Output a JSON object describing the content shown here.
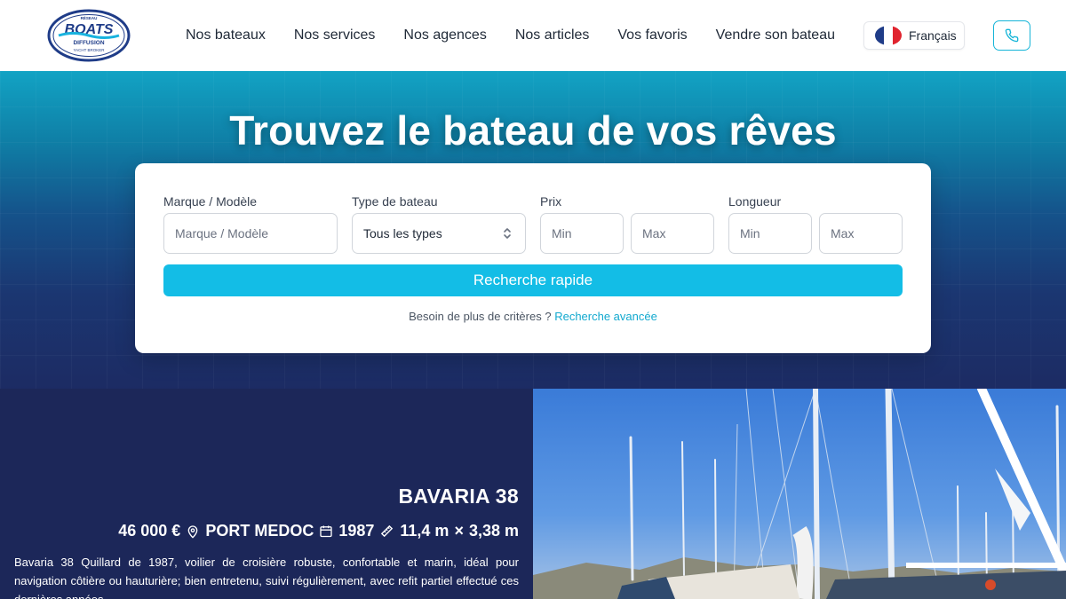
{
  "header": {
    "logo": {
      "top": "RÉSEAU",
      "main": "BOATS",
      "sub": "DIFFUSION",
      "tagline": "YACHT BROKER"
    },
    "nav": [
      "Nos bateaux",
      "Nos services",
      "Nos agences",
      "Nos articles",
      "Vos favoris",
      "Vendre son bateau"
    ],
    "language": "Français",
    "phone_icon": "phone-icon"
  },
  "hero": {
    "title": "Trouvez le bateau de vos rêves"
  },
  "search": {
    "brand_label": "Marque / Modèle",
    "brand_placeholder": "Marque / Modèle",
    "type_label": "Type de bateau",
    "type_value": "Tous les types",
    "price_label": "Prix",
    "price_min": "Min",
    "price_max": "Max",
    "length_label": "Longueur",
    "length_min": "Min",
    "length_max": "Max",
    "button": "Recherche rapide",
    "advanced_prefix": "Besoin de plus de critères ?",
    "advanced_link": "Recherche avancée"
  },
  "listing": {
    "name": "BAVARIA 38",
    "price": "46 000 €",
    "location": "PORT MEDOC",
    "year": "1987",
    "length": "11,4 m",
    "times": "×",
    "width": "3,38 m",
    "description": "Bavaria 38 Quillard de 1987, voilier de croisière robuste, confortable et marin, idéal pour navigation côtière ou hauturière; bien entretenu, suivi régulièrement, avec refit partiel effectué ces dernières années."
  },
  "colors": {
    "accent": "#13bde6",
    "navy": "#1c2759",
    "hero_top": "#12a3c4"
  }
}
